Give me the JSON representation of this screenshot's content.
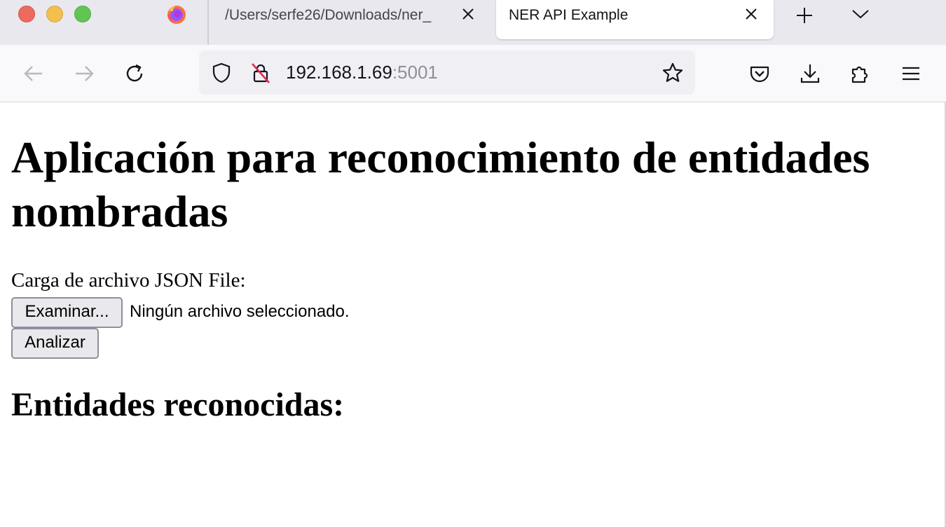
{
  "browser": {
    "tabs": [
      {
        "title": "/Users/serfe26/Downloads/ner_",
        "active": false
      },
      {
        "title": "NER API Example",
        "active": true
      }
    ],
    "url": {
      "host": "192.168.1.69",
      "port": ":5001"
    },
    "icons": {
      "back": "arrow-left-icon",
      "forward": "arrow-right-icon",
      "reload": "reload-icon",
      "shield": "shield-icon",
      "insecure": "insecure-lock-icon",
      "bookmark": "star-icon",
      "pocket": "pocket-icon",
      "downloads": "download-icon",
      "extensions": "puzzle-icon",
      "menu": "hamburger-menu-icon"
    }
  },
  "page": {
    "title": "Aplicación para reconocimiento de entidades nombradas",
    "file_label": "Carga de archivo JSON File:",
    "file_button": "Examinar...",
    "file_status": "Ningún archivo seleccionado.",
    "analyze_button": "Analizar",
    "results_heading": "Entidades reconocidas:"
  }
}
